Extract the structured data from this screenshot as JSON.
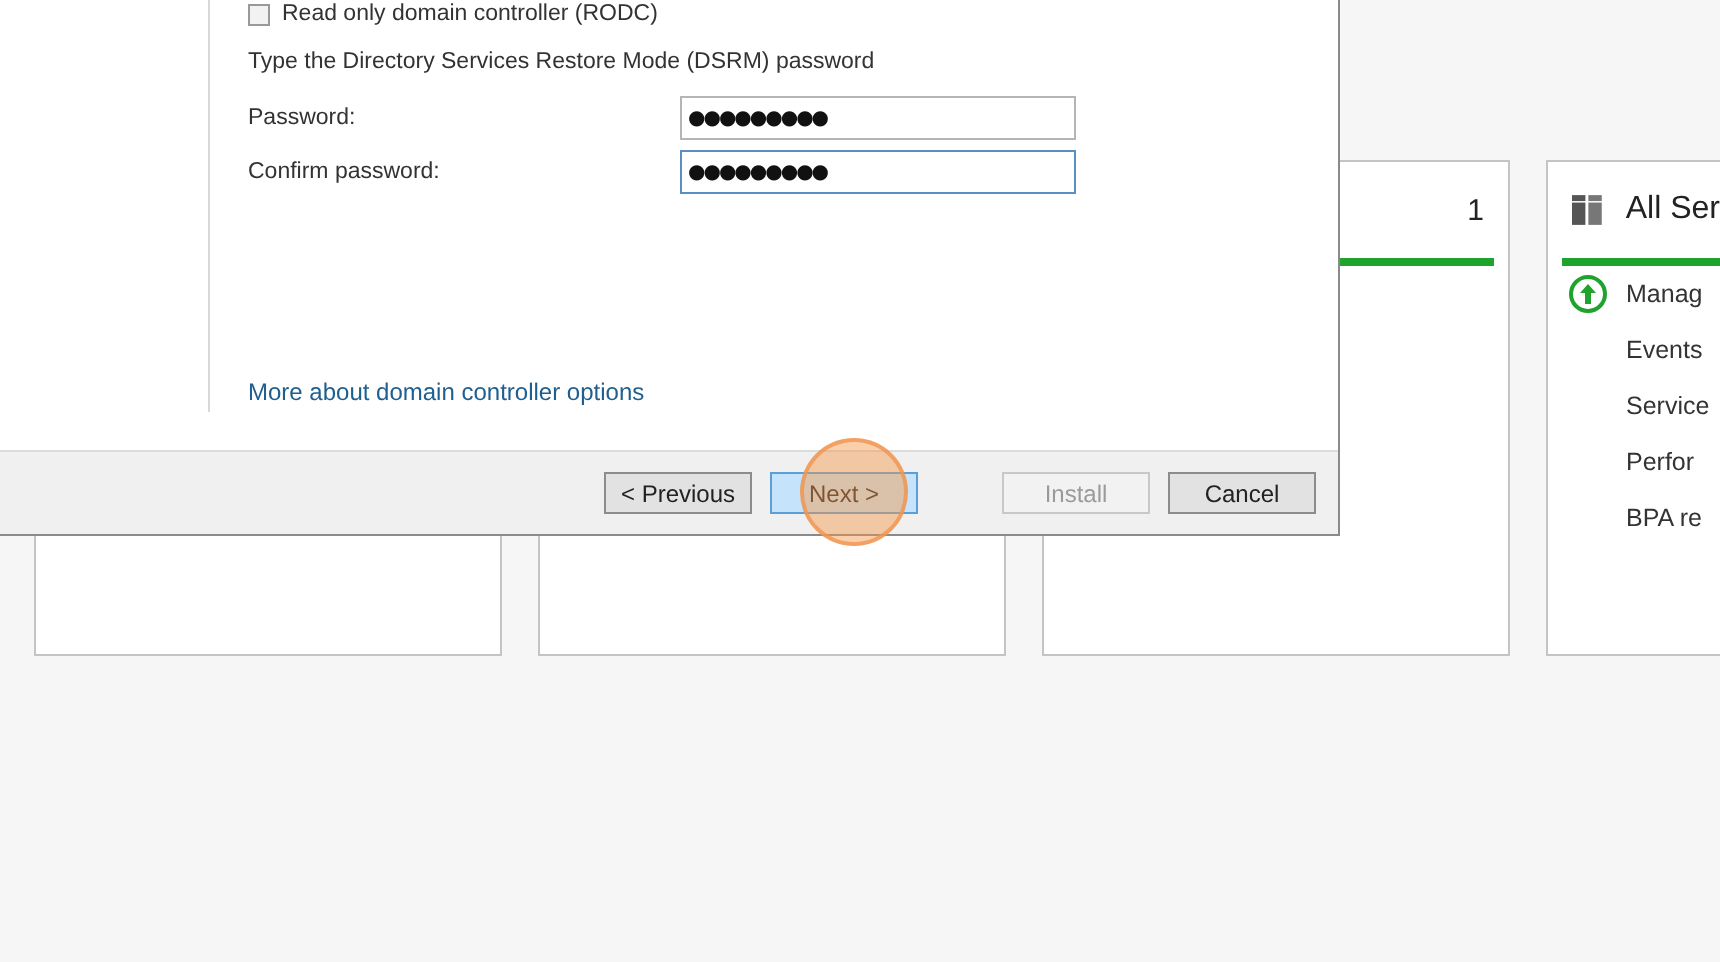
{
  "dialog": {
    "checkbox": {
      "label": "Read only domain controller (RODC)",
      "checked": false
    },
    "dsrm_heading": "Type the Directory Services Restore Mode (DSRM) password",
    "fields": [
      {
        "label": "Password:",
        "value": "●●●●●●●●●",
        "focused": false
      },
      {
        "label": "Confirm password:",
        "value": "●●●●●●●●●",
        "focused": true
      }
    ],
    "link": "More about domain controller options",
    "buttons": [
      {
        "label": "< Previous",
        "highlighted": false,
        "disabled": false,
        "clicked": false
      },
      {
        "label": "Next >",
        "highlighted": true,
        "disabled": false,
        "clicked": true
      },
      {
        "label": "Install",
        "highlighted": false,
        "disabled": true,
        "clicked": false
      },
      {
        "label": "Cancel",
        "highlighted": false,
        "disabled": false,
        "clicked": false
      }
    ]
  },
  "tiles": [
    {
      "kind": "blank"
    },
    {
      "kind": "blank"
    },
    {
      "kind": "count",
      "count": "1"
    },
    {
      "kind": "group",
      "title": "All Ser",
      "items": [
        {
          "label": "Manag",
          "alert": true
        },
        {
          "label": "Events",
          "alert": false
        },
        {
          "label": "Service",
          "alert": false
        },
        {
          "label": "Perfor",
          "alert": false
        },
        {
          "label": "BPA re",
          "alert": false
        }
      ]
    }
  ]
}
